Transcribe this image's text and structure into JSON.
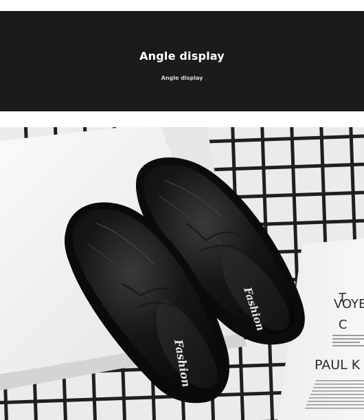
{
  "header": {
    "title": "Angle display",
    "subtitle": "Angle display",
    "background": "#1b1b1b"
  },
  "photo": {
    "insole_brand": "Fashion",
    "magazine": {
      "line1": "T",
      "line2": "VOYE",
      "line3": "C",
      "line4": "PAUL K"
    }
  },
  "colors": {
    "shoe": "#111111",
    "grid_floor": "#e8e8ea",
    "grid_lines": "#1e1e1e",
    "box": "#f4f4f4"
  }
}
